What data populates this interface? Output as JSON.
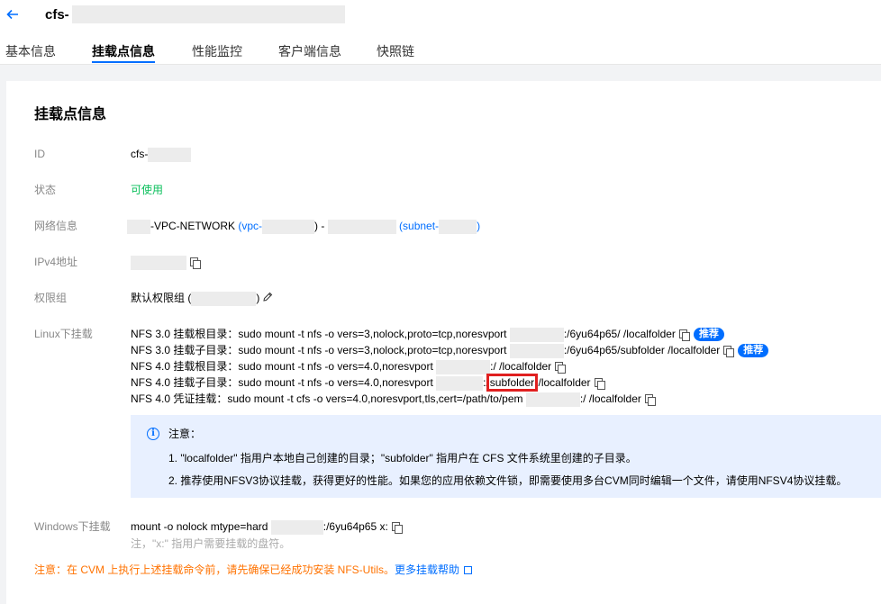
{
  "header": {
    "title": "cfs-",
    "tabs": [
      "基本信息",
      "挂载点信息",
      "性能监控",
      "客户端信息",
      "快照链"
    ],
    "active_tab": "挂载点信息"
  },
  "card": {
    "title": "挂载点信息",
    "fields": {
      "id_label": "ID",
      "id_value": "cfs-",
      "status_label": "状态",
      "status_value": "可使用",
      "network_label": "网络信息",
      "network_name": "-VPC-NETWORK",
      "network_vpc_open": "(vpc-",
      "network_vpc_close": ")",
      "network_sep": " - ",
      "network_subnet_open": "(subnet-",
      "network_subnet_close": ")",
      "ipv4_label": "IPv4地址",
      "perm_label": "权限组",
      "perm_value": "默认权限组 (",
      "perm_close": ")"
    },
    "linux": {
      "label": "Linux下挂载",
      "lines": [
        {
          "prefix": "NFS 3.0 挂载根目录：sudo mount -t nfs -o vers=3,nolock,proto=tcp,noresvport ",
          "suffix": ":/6yu64p65/ /localfolder",
          "badge": "推荐"
        },
        {
          "prefix": "NFS 3.0 挂载子目录：sudo mount -t nfs -o vers=3,nolock,proto=tcp,noresvport ",
          "suffix": ":/6yu64p65/subfolder /localfolder",
          "badge": "推荐"
        },
        {
          "prefix": "NFS 4.0 挂载根目录：sudo mount -t nfs -o vers=4.0,noresvport ",
          "suffix": ":/ /localfolder"
        },
        {
          "prefix": "NFS 4.0 挂载子目录：sudo mount -t nfs -o vers=4.0,noresvport ",
          "mid_pre": ":/",
          "highlight": "subfolder",
          "suffix": " /localfolder"
        },
        {
          "prefix": "NFS 4.0 凭证挂载：sudo mount -t cfs -o vers=4.0,noresvport,tls,cert=/path/to/pem ",
          "suffix": ":/ /localfolder"
        }
      ]
    },
    "notice": {
      "title": "注意：",
      "line1": "1. \"localfolder\" 指用户本地自己创建的目录；\"subfolder\" 指用户在 CFS 文件系统里创建的子目录。",
      "line2": "2. 推荐使用NFSV3协议挂载，获得更好的性能。如果您的应用依赖文件锁，即需要使用多台CVM同时编辑一个文件，请使用NFSV4协议挂载。"
    },
    "windows": {
      "label": "Windows下挂载",
      "cmd_prefix": "mount -o nolock mtype=hard ",
      "cmd_suffix": ":/6yu64p65 x:",
      "hint": "注，\"x:\" 指用户需要挂载的盘符。"
    },
    "warning": {
      "text": "注意：在 CVM 上执行上述挂载命令前，请先确保已经成功安装 NFS-Utils。",
      "link": "更多挂载帮助"
    }
  },
  "colors": {
    "accent": "#006eff",
    "success": "#0abf5b",
    "warning": "#ff7200",
    "highlight_box": "#e02020"
  }
}
